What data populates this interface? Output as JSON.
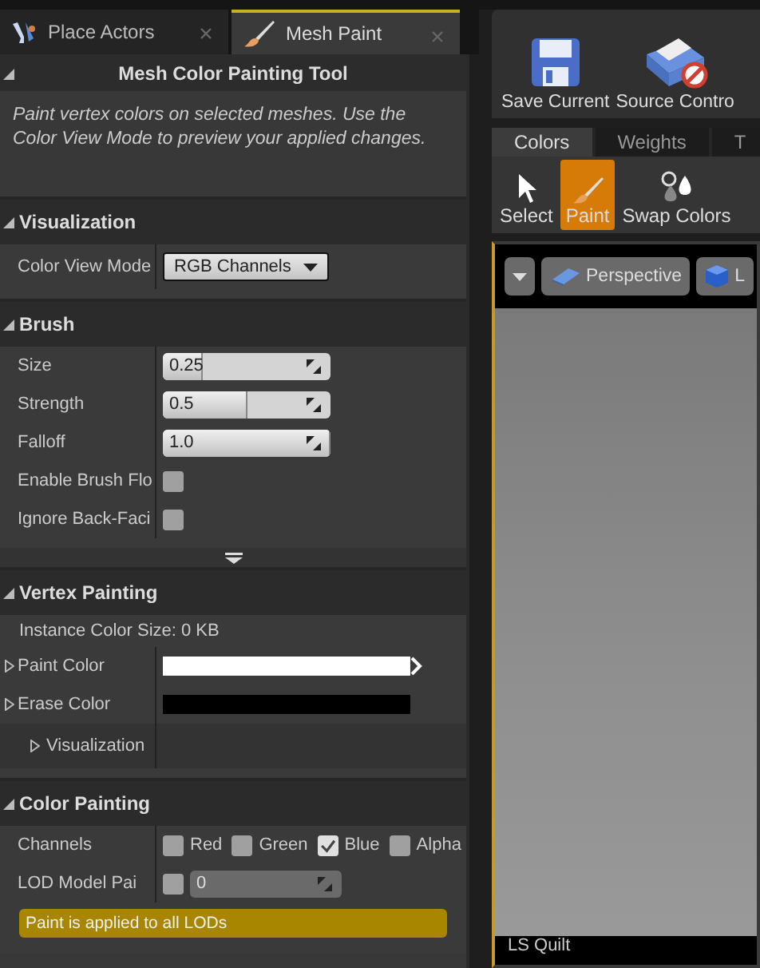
{
  "tabs": [
    {
      "label": "Place Actors",
      "selected": false
    },
    {
      "label": "Mesh Paint",
      "selected": true
    }
  ],
  "tool_title": "Mesh Color Painting Tool",
  "description": "Paint vertex colors on selected meshes.  Use the Color View Mode to preview your applied changes.",
  "sections": [
    {
      "title": "Visualization",
      "expanded": true,
      "rows": [
        {
          "kind": "dropdown",
          "label": "Color View Mode",
          "value": "RGB Channels"
        }
      ]
    },
    {
      "title": "Brush",
      "expanded": true,
      "more": true,
      "rows": [
        {
          "kind": "spin",
          "label": "Size",
          "value": "0.25",
          "level": 0.24
        },
        {
          "kind": "spin",
          "label": "Strength",
          "value": "0.5",
          "level": 0.5
        },
        {
          "kind": "spin",
          "label": "Falloff",
          "value": "1.0",
          "level": 1
        },
        {
          "kind": "checkbox",
          "label": "Enable Brush Flo",
          "checked": false
        },
        {
          "kind": "checkbox",
          "label": "Ignore Back-Faci",
          "checked": false
        }
      ]
    },
    {
      "title": "Vertex Painting",
      "expanded": true,
      "rows": [
        {
          "kind": "info",
          "label": "Instance Color Size: 0 KB"
        },
        {
          "kind": "color",
          "label": "Paint Color",
          "color": "#ffffff",
          "expanded": false
        },
        {
          "kind": "color",
          "label": "Erase Color",
          "color": "#000000",
          "expanded": false
        },
        {
          "kind": "subsection",
          "label": "Visualization",
          "expanded": false
        }
      ]
    },
    {
      "title": "Color Painting",
      "expanded": true,
      "rows": [
        {
          "kind": "channels",
          "label": "Channels",
          "channels": [
            {
              "label": "Red",
              "checked": false
            },
            {
              "label": "Green",
              "checked": false
            },
            {
              "label": "Blue",
              "checked": true
            },
            {
              "label": "Alpha",
              "checked": false
            }
          ]
        },
        {
          "kind": "lod",
          "label": "LOD Model Pai",
          "checked": false,
          "value": "0",
          "disabled": true
        },
        {
          "kind": "warning",
          "label": "Paint is applied to all LODs"
        }
      ]
    }
  ],
  "toolbar": [
    {
      "label": "Save Current"
    },
    {
      "label": "Source Contro"
    }
  ],
  "mode_tabs": [
    {
      "label": "Colors",
      "selected": true
    },
    {
      "label": "Weights",
      "selected": false
    },
    {
      "label": "T",
      "selected": false
    }
  ],
  "tools": [
    {
      "label": "Select",
      "selected": false
    },
    {
      "label": "Paint",
      "selected": true
    },
    {
      "label": "Swap Colors",
      "selected": false
    }
  ],
  "viewport": {
    "view": "Perspective",
    "mode": "L",
    "caption": "LS Quilt"
  }
}
